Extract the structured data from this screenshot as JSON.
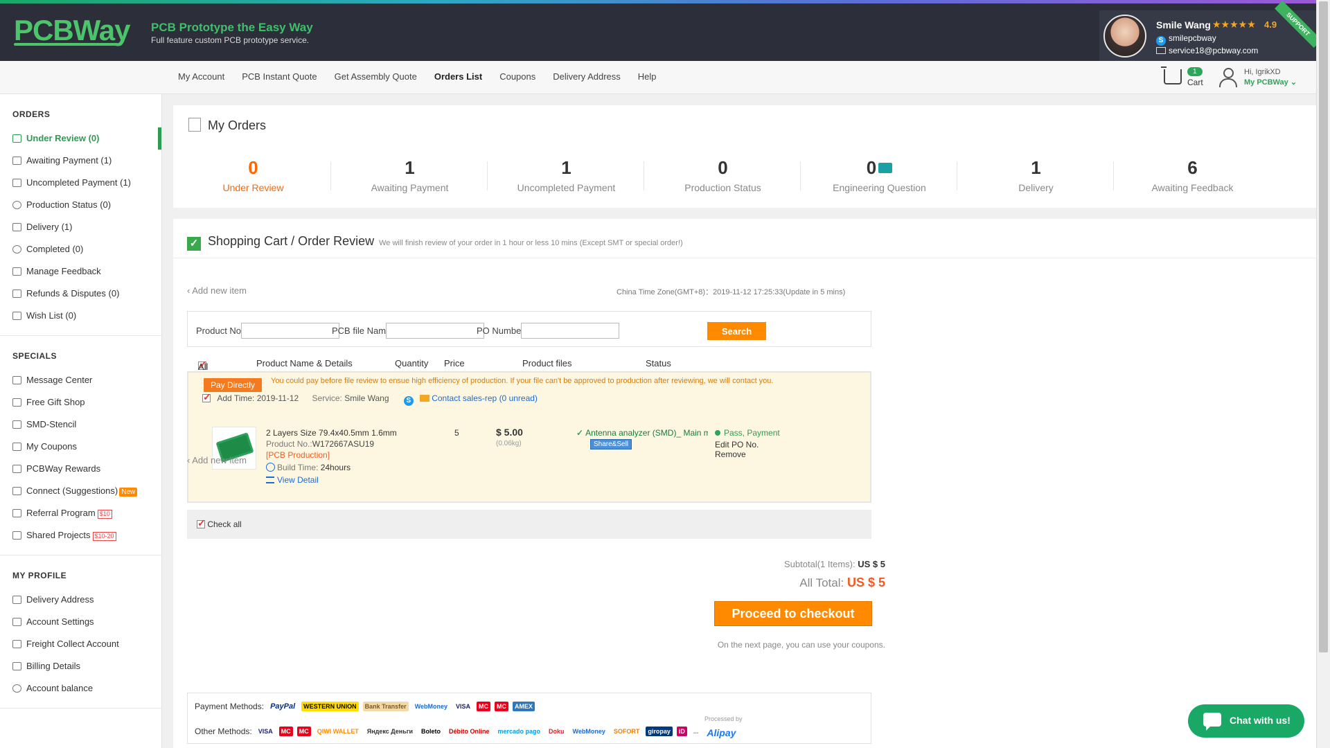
{
  "header": {
    "logo": "PCBWay",
    "tagline": "PCB Prototype the Easy Way",
    "tagline_sub": "Full feature custom PCB prototype service.",
    "support": {
      "name": "Smile Wang",
      "stars": "★★★★★",
      "rating": "4.9",
      "skype": "smilepcbway",
      "email": "service18@pcbway.com",
      "ribbon": "SUPPORT"
    }
  },
  "nav": {
    "items": [
      "My Account",
      "PCB Instant Quote",
      "Get Assembly Quote",
      "Orders List",
      "Coupons",
      "Delivery Address",
      "Help"
    ],
    "active": "Orders List",
    "cart_count": "1",
    "cart_label": "Cart",
    "greeting": "Hi, IgrikXD",
    "my_pcbway": "My PCBWay ⌄"
  },
  "sidebar": {
    "orders_title": "ORDERS",
    "orders": [
      "Under Review (0)",
      "Awaiting Payment (1)",
      "Uncompleted Payment (1)",
      "Production Status (0)",
      "Delivery (1)",
      "Completed (0)",
      "Manage Feedback",
      "Refunds & Disputes (0)",
      "Wish List (0)"
    ],
    "specials_title": "SPECIALS",
    "specials": [
      "Message Center",
      "Free Gift Shop",
      "SMD-Stencil",
      "My Coupons",
      "PCBWay Rewards",
      "Connect (Suggestions)",
      "Referral Program",
      "Shared Projects"
    ],
    "tags": {
      "new": "New",
      "referral": "$10",
      "shared": "$10-20"
    },
    "profile_title": "MY PROFILE",
    "profile": [
      "Delivery Address",
      "Account Settings",
      "Freight Collect Account",
      "Billing Details",
      "Account balance"
    ]
  },
  "summary": {
    "title": "My Orders",
    "stats": [
      {
        "num": "0",
        "label": "Under Review"
      },
      {
        "num": "1",
        "label": "Awaiting Payment"
      },
      {
        "num": "1",
        "label": "Uncompleted Payment"
      },
      {
        "num": "0",
        "label": "Production Status"
      },
      {
        "num": "0",
        "label": "Engineering Question"
      },
      {
        "num": "1",
        "label": "Delivery"
      },
      {
        "num": "6",
        "label": "Awaiting Feedback"
      }
    ]
  },
  "cart": {
    "title": "Shopping Cart / Order Review",
    "note": "We will finish review of your order in 1 hour or less 10 mins (Except SMT or special order!)",
    "add_new": "‹ Add new item",
    "timezone": "China Time Zone(GMT+8)：2019-11-12 17:25:33(Update in 5 mins)",
    "search": {
      "product_no_label": "Product No.:",
      "pcb_file_label": "PCB file Name:",
      "po_label": "PO Number:",
      "button": "Search"
    },
    "columns": [
      "All",
      "Product Name & Details",
      "Quantity",
      "Price",
      "Product files",
      "Status"
    ],
    "order": {
      "pay_tag": "Pay Directly",
      "pay_note": "You could pay before file review to ensue high efficiency of production. If your file can't be approved to production after reviewing, we will contact you.",
      "add_time": "Add Time: 2019-11-12",
      "service_label": "Service:",
      "service_name": "Smile Wang",
      "contact": "Contact sales-rep (0 unread)",
      "title": "2 Layers Size 79.4x40.5mm 1.6mm",
      "product_no_label": "Product No.:",
      "product_no": "W172667ASU19",
      "tag": "[PCB Production]",
      "build_label": "Build Time:",
      "build_time": "24hours",
      "view_detail": "View Detail",
      "quantity": "5",
      "price": "$ 5.00",
      "weight": "(0.06kg)",
      "file": "Antenna analyzer (SMD)_ Main module",
      "share": "Share&Sell",
      "status": "Pass, Payment",
      "edit_po": "Edit PO No.",
      "remove": "Remove"
    },
    "check_all": "Check all",
    "subtotal_label": "Subtotal(1 Items):",
    "subtotal": "US $ 5",
    "all_total_label": "All Total:",
    "all_total": "US $ 5",
    "checkout": "Proceed to checkout",
    "coupon_note": "On the next page, you can use your coupons."
  },
  "payment": {
    "methods_label": "Payment Methods:",
    "other_label": "Other Methods:",
    "methods": [
      "PayPal",
      "WESTERN UNION",
      "Bank Transfer",
      "WebMoney",
      "VISA",
      "MC",
      "MC",
      "AMEX"
    ],
    "others": [
      "VISA",
      "MC",
      "MC",
      "QIWI WALLET",
      "Яндекс Деньги",
      "Boleto",
      "Débito Online",
      "mercado pago",
      "Doku",
      "WebMoney",
      "SOFORT",
      "giropay",
      "iD",
      "...",
      "Alipay"
    ],
    "alipay_note": "Processed by"
  },
  "chat": {
    "label": "Chat with us!"
  },
  "colors": {
    "brand": "#2e9b53",
    "accent": "#ff8a00",
    "header": "#2c2f3a"
  }
}
